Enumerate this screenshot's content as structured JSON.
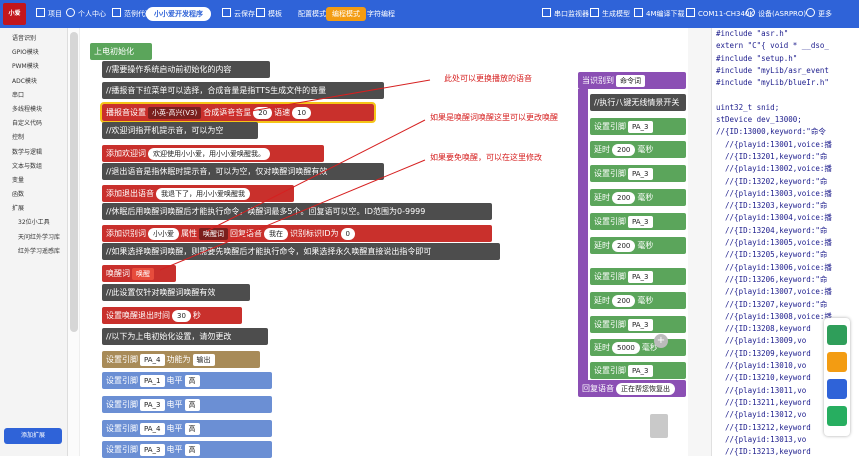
{
  "topbar": {
    "logo": "小爱",
    "items": [
      "项目",
      "个人中心",
      "范例代码"
    ],
    "active_tab": "小小爱开发程序",
    "save_cloud": "云保存",
    "template": "模板",
    "modes": [
      "配置模式",
      "编程模式",
      "字符编程"
    ],
    "right": [
      "串口监视器",
      "生成模型",
      "4M编译下载",
      "COM11-CH340K",
      "设备(ASRPRO)",
      "更多"
    ]
  },
  "sidebar": {
    "items": [
      "语音识别",
      "GPIO模块",
      "PWM模块",
      "ADC模块",
      "串口",
      "多线程模块",
      "自定义代码",
      "控制",
      "数学与逻辑",
      "文本与数组",
      "变量",
      "函数",
      "扩展"
    ],
    "sub_items": [
      "32位小工具",
      "天问红外学习库",
      "红外学习遥感库"
    ],
    "add_ext": "添加扩展"
  },
  "blocks": {
    "hat": "上电初始化",
    "c1": "//需要操作系统启动前初始化的内容",
    "c2": "//播报音下拉菜单可以选择，合成音量是指TTS生成文件的音量",
    "tts_label": "播报音设置",
    "tts_voice": "小英-高兴(V3)",
    "tts_vol_label": "合成语音音量",
    "tts_vol": "20",
    "tts_speed_label": "语速",
    "tts_speed": "10",
    "c3": "//欢迎词指开机提示音，可以为空",
    "welcome_label": "添加欢迎词",
    "welcome_text": "欢迎使用小小爱，用小小爱唤醒我。",
    "c4": "//退出语音是指休眠时提示音，可以为空，仅对唤醒词唤醒有效",
    "exit_label": "添加退出语音",
    "exit_text": "我退下了，用小小爱唤醒我",
    "c5": "//休眠后用唤醒词唤醒后才能执行命令，唤醒词最多5个。回复语可以空。ID范围为0-9999",
    "wake_label": "添加识别词",
    "wake_word": "小小爱",
    "wake_attr": "属性",
    "wake_type": "唤醒词",
    "reply_label": "回复语音",
    "reply_text": "我在",
    "id_label": "识别标识ID为",
    "id_value": "0",
    "c6": "//如果选择唤醒词唤醒，则需要先唤醒后才能执行命令，如果选择永久唤醒直接说出指令即可",
    "wake_mode": "唤醒词",
    "wake_mode_sel": "唤醒",
    "c7": "//此设置仅针对唤醒词唤醒有效",
    "timeout_label": "设置唤醒退出时间",
    "timeout_value": "30",
    "timeout_unit": "秒",
    "c8": "//以下为上电初始化设置，请勿更改",
    "pin_label": "设置引脚",
    "pin_main": "PA_4",
    "func_label": "功能为",
    "func_value": "输出",
    "pins": [
      "PA_1",
      "PA_3",
      "PA_4",
      "PA_3"
    ],
    "level_label": "电平",
    "level_value": "高"
  },
  "right_blocks": {
    "header": "当识别到",
    "header_sel": "命令词",
    "comment": "//执行八键无线情景开关",
    "set_pin": "设置引脚",
    "pin": "PA_3",
    "delay_label": "延时",
    "delay_values": [
      "200",
      "200",
      "200",
      "200",
      "5000",
      "200"
    ],
    "delay_unit": "毫秒",
    "reply_label": "回复语音",
    "reply_text": "正在帮您恢复出"
  },
  "annotations": [
    "此处可以更换播放的语音",
    "如果是唤醒词唤醒这里可以更改唤醒",
    "如果要免唤醒，可以在这里修改"
  ],
  "code": {
    "lines": [
      "#include \"asr.h\"",
      "extern \"C\"{ void * __dso_",
      "#include \"setup.h\"",
      "#include \"myLib/asr_event",
      "#include \"myLib/blueIr.h\"",
      "",
      "uint32_t snid;",
      "stDevice dev_13000;",
      "//{ID:13000,keyword:\"命令",
      "  //{playid:13001,voice:播",
      "  //{ID:13201,keyword:\"命",
      "  //{playid:13002,voice:播",
      "  //{ID:13202,keyword:\"命",
      "  //{playid:13003,voice:播",
      "  //{ID:13203,keyword:\"命",
      "  //{playid:13004,voice:播",
      "  //{ID:13204,keyword:\"命",
      "  //{playid:13005,voice:播",
      "  //{ID:13205,keyword:\"命",
      "  //{playid:13006,voice:播",
      "  //{ID:13206,keyword:\"命",
      "  //{playid:13007,voice:播",
      "  //{ID:13207,keyword:\"命",
      "  //{playid:13008,voice:播",
      "  //{ID:13208,keyword",
      "  //{playid:13009,vo",
      "  //{ID:13209,keyword",
      "  //{playid:13010,vo",
      "  //{ID:13210,keyword",
      "  //{playid:13011,vo",
      "  //{ID:13211,keyword",
      "  //{playid:13012,vo",
      "  //{ID:13212,keyword",
      "  //{playid:13013,vo",
      "  //{ID:13213,keyword",
      "  //{playid:13014,voice:"
    ]
  },
  "colors": {
    "topbar": "#2f63d8",
    "accent": "#f39c12",
    "annotation": "#d62020"
  }
}
